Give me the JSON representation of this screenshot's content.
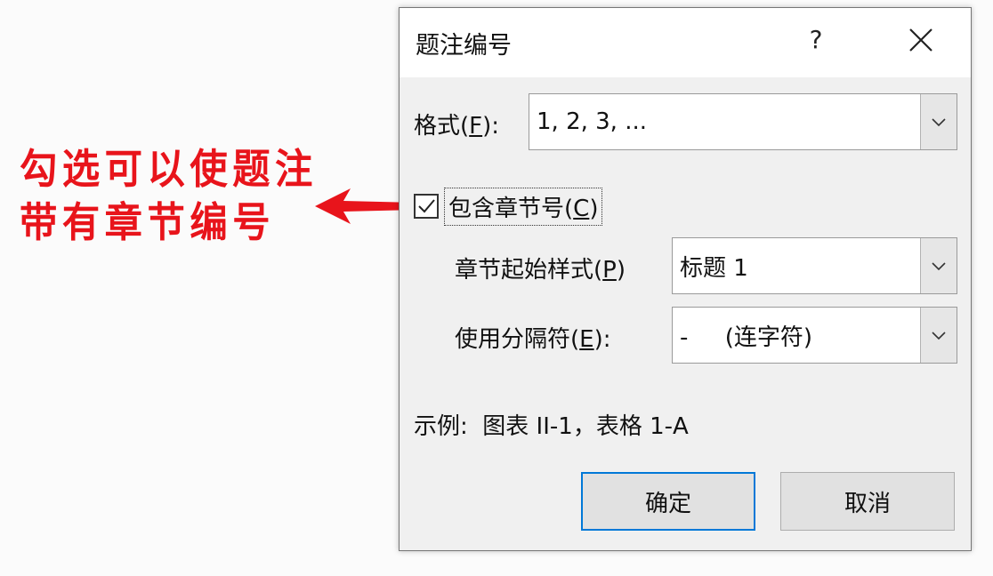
{
  "annotation": {
    "line1": "勾选可以使题注",
    "line2": "带有章节编号",
    "color": "#e8141b"
  },
  "dialog": {
    "title": "题注编号",
    "help_label": "?",
    "close_icon": "close-icon",
    "format": {
      "label": "格式",
      "hotkey": "F",
      "value": "1, 2, 3, ..."
    },
    "include_chapter": {
      "label": "包含章节号",
      "hotkey": "C",
      "checked": true
    },
    "chapter_style": {
      "label": "章节起始样式",
      "hotkey": "P",
      "value": "标题 1"
    },
    "separator": {
      "label": "使用分隔符",
      "hotkey": "E",
      "value": "-     (连字符)"
    },
    "example": {
      "label": "示例:",
      "value": "图表 II-1，表格 1-A"
    },
    "ok_label": "确定",
    "cancel_label": "取消",
    "accent": "#0078d7"
  }
}
